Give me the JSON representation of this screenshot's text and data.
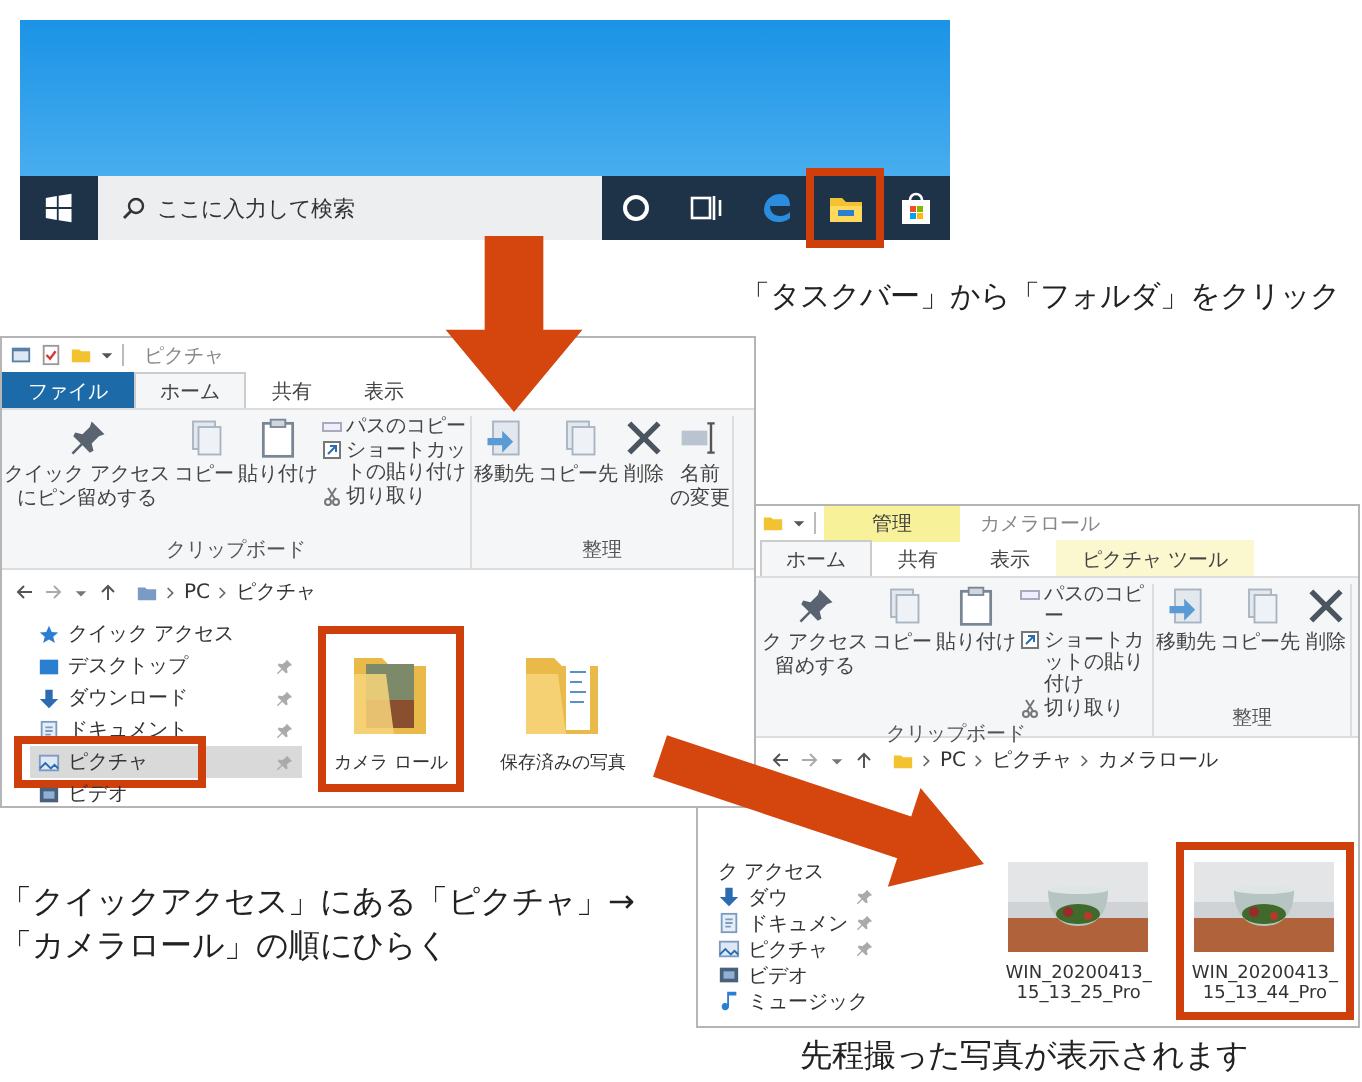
{
  "taskbar": {
    "search": {
      "placeholder": "ここに入力して検索"
    },
    "icons": [
      {
        "kind": "cortana",
        "highlighted": false
      },
      {
        "kind": "taskview",
        "highlighted": false
      },
      {
        "kind": "edge",
        "highlighted": false
      },
      {
        "kind": "explorer",
        "highlighted": true
      },
      {
        "kind": "store",
        "highlighted": false
      }
    ]
  },
  "windows": [
    {
      "title": "ピクチャ",
      "tabs": [
        {
          "label": "ファイル",
          "kind": "file",
          "selected": false
        },
        {
          "label": "ホーム",
          "kind": "tab",
          "selected": true
        },
        {
          "label": "共有",
          "kind": "tab",
          "selected": false
        },
        {
          "label": "表示",
          "kind": "tab",
          "selected": false
        }
      ],
      "ribbon": [
        {
          "label": "クリップボード",
          "buttons": [
            {
              "kind": "pin",
              "lines": [
                "クイック アクセス",
                "にピン留めする"
              ]
            },
            {
              "kind": "copy",
              "lines": [
                "コピー"
              ]
            },
            {
              "kind": "paste",
              "lines": [
                "貼り付け"
              ]
            },
            {
              "kind": "stack",
              "items": [
                {
                  "kind": "path",
                  "label": "パスのコピー"
                },
                {
                  "kind": "shortcut",
                  "label": "ショートカットの貼り付け"
                },
                {
                  "kind": "cut",
                  "label": "切り取り"
                }
              ]
            }
          ]
        },
        {
          "label": "整理",
          "buttons": [
            {
              "kind": "move",
              "lines": [
                "移動先"
              ]
            },
            {
              "kind": "copyto",
              "lines": [
                "コピー先"
              ]
            },
            {
              "kind": "delete",
              "lines": [
                "削除"
              ]
            },
            {
              "kind": "rename",
              "lines": [
                "名前",
                "の変更"
              ]
            }
          ]
        }
      ],
      "address": [
        "PC",
        "ピクチャ"
      ],
      "nav": [
        {
          "label": "クイック アクセス",
          "kind": "star",
          "pinned": false,
          "selected": false,
          "highlighted": false
        },
        {
          "label": "デスクトップ",
          "kind": "desktop",
          "pinned": true,
          "selected": false,
          "highlighted": false
        },
        {
          "label": "ダウンロード",
          "kind": "download",
          "pinned": true,
          "selected": false,
          "highlighted": false
        },
        {
          "label": "ドキュメント",
          "kind": "document",
          "pinned": true,
          "selected": false,
          "highlighted": false
        },
        {
          "label": "ピクチャ",
          "kind": "pictures",
          "pinned": true,
          "selected": true,
          "highlighted": true
        },
        {
          "label": "ビデオ",
          "kind": "video",
          "pinned": false,
          "selected": false,
          "highlighted": false
        }
      ],
      "items": [
        {
          "lines": [
            "カメラ ロール"
          ],
          "kind": "photo-folder",
          "highlighted": true
        },
        {
          "lines": [
            "保存済みの写真"
          ],
          "kind": "doc-folder",
          "highlighted": false
        }
      ]
    },
    {
      "title": "カメラロール",
      "context_label": "管理",
      "tabs": [
        {
          "label": "ホーム",
          "kind": "tab",
          "selected": true
        },
        {
          "label": "共有",
          "kind": "tab",
          "selected": false
        },
        {
          "label": "表示",
          "kind": "tab",
          "selected": false
        },
        {
          "label": "ピクチャ ツール",
          "kind": "context",
          "selected": false
        }
      ],
      "ribbon": [
        {
          "label": "クリップボード",
          "buttons": [
            {
              "kind": "pin",
              "lines": [
                "ク アクセス",
                "留めする"
              ]
            },
            {
              "kind": "copy",
              "lines": [
                "コピー"
              ]
            },
            {
              "kind": "paste",
              "lines": [
                "貼り付け"
              ]
            },
            {
              "kind": "stack",
              "items": [
                {
                  "kind": "path",
                  "label": "パスのコピー"
                },
                {
                  "kind": "shortcut",
                  "label": "ショートカットの貼り付け"
                },
                {
                  "kind": "cut",
                  "label": "切り取り"
                }
              ]
            }
          ]
        },
        {
          "label": "整理",
          "buttons": [
            {
              "kind": "move",
              "lines": [
                "移動先"
              ]
            },
            {
              "kind": "copyto",
              "lines": [
                "コピー先"
              ]
            },
            {
              "kind": "delete",
              "lines": [
                "削除"
              ]
            }
          ]
        }
      ],
      "address": [
        "PC",
        "ピクチャ",
        "カメラロール"
      ],
      "nav": [
        {
          "label": "ク アクセス",
          "kind": "none",
          "pinned": false,
          "selected": false,
          "highlighted": false
        },
        {
          "label": "ダウ",
          "kind": "download",
          "pinned": true,
          "selected": false,
          "highlighted": false
        },
        {
          "label": "ドキュメン",
          "kind": "document",
          "pinned": true,
          "selected": false,
          "highlighted": false
        },
        {
          "label": "ピクチャ",
          "kind": "pictures",
          "pinned": true,
          "selected": false,
          "highlighted": false
        },
        {
          "label": "ビデオ",
          "kind": "video",
          "pinned": false,
          "selected": false,
          "highlighted": false
        },
        {
          "label": "ミュージック",
          "kind": "music",
          "pinned": false,
          "selected": false,
          "highlighted": false
        }
      ],
      "items": [
        {
          "lines": [
            "WIN_20200413_",
            "15_13_25_Pro"
          ],
          "highlighted": false
        },
        {
          "lines": [
            "WIN_20200413_",
            "15_13_44_Pro"
          ],
          "highlighted": true
        }
      ]
    }
  ],
  "captions": [
    {
      "lines": [
        "「タスクバー」から「フォルダ」をクリック"
      ]
    },
    {
      "lines": [
        "「クイックアクセス」にある「ピクチャ」→",
        "「カメラロール」の順にひらく"
      ]
    },
    {
      "lines": [
        "先程撮った写真が表示されます"
      ]
    }
  ]
}
